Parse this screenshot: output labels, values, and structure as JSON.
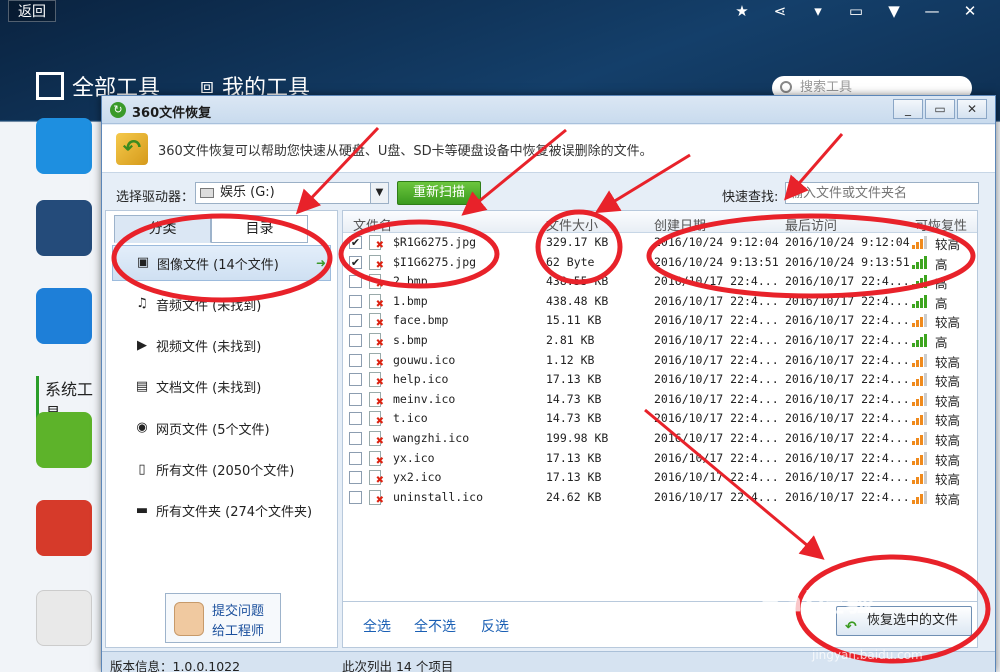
{
  "background": {
    "back_label": "返回",
    "tabs": [
      "全部工具",
      "我的工具"
    ],
    "search_placeholder": "搜索工具",
    "section_label": "系统工具"
  },
  "window": {
    "title": "360文件恢复",
    "controls": [
      "minimize-icon",
      "maximize-icon",
      "close-icon"
    ],
    "description": "360文件恢复可以帮助您快速从硬盘、U盘、SD卡等硬盘设备中恢复被误删除的文件。",
    "drive_label": "选择驱动器：",
    "drive_value": "娱乐 (G:)",
    "rescan_label": "重新扫描",
    "quicksearch_label": "快速查找:",
    "quicksearch_placeholder": "输入文件或文件夹名"
  },
  "left_panel": {
    "tabs": [
      "分类",
      "目录"
    ],
    "categories": [
      {
        "label": "图像文件 (14个文件)",
        "icon": "image-icon",
        "active": true
      },
      {
        "label": "音频文件 (未找到)",
        "icon": "music-icon"
      },
      {
        "label": "视频文件 (未找到)",
        "icon": "video-icon"
      },
      {
        "label": "文档文件 (未找到)",
        "icon": "document-icon"
      },
      {
        "label": "网页文件 (5个文件)",
        "icon": "webpage-icon"
      },
      {
        "label": "所有文件 (2050个文件)",
        "icon": "file-icon"
      },
      {
        "label": "所有文件夹 (274个文件夹)",
        "icon": "folder-icon"
      }
    ],
    "feedback_line1": "提交问题",
    "feedback_line2": "给工程师"
  },
  "file_table": {
    "columns": [
      "文件名",
      "文件大小",
      "创建日期",
      "最后访问",
      "可恢复性"
    ],
    "rows": [
      {
        "checked": true,
        "name": "$R1G6275.jpg",
        "size": "329.17 KB",
        "created": "2016/10/24 9:12:04",
        "accessed": "2016/10/24 9:12:04",
        "recover": "较高",
        "bars": 3
      },
      {
        "checked": true,
        "name": "$I1G6275.jpg",
        "size": "62 Byte",
        "created": "2016/10/24 9:13:51",
        "accessed": "2016/10/24 9:13:51",
        "recover": "高",
        "bars": 4
      },
      {
        "checked": false,
        "name": "2.bmp",
        "size": "438.55 KB",
        "created": "2016/10/17 22:4...",
        "accessed": "2016/10/17 22:4...",
        "recover": "高",
        "bars": 4
      },
      {
        "checked": false,
        "name": "1.bmp",
        "size": "438.48 KB",
        "created": "2016/10/17 22:4...",
        "accessed": "2016/10/17 22:4...",
        "recover": "高",
        "bars": 4
      },
      {
        "checked": false,
        "name": "face.bmp",
        "size": "15.11 KB",
        "created": "2016/10/17 22:4...",
        "accessed": "2016/10/17 22:4...",
        "recover": "较高",
        "bars": 3
      },
      {
        "checked": false,
        "name": "s.bmp",
        "size": "2.81 KB",
        "created": "2016/10/17 22:4...",
        "accessed": "2016/10/17 22:4...",
        "recover": "高",
        "bars": 4
      },
      {
        "checked": false,
        "name": "gouwu.ico",
        "size": "1.12 KB",
        "created": "2016/10/17 22:4...",
        "accessed": "2016/10/17 22:4...",
        "recover": "较高",
        "bars": 3
      },
      {
        "checked": false,
        "name": "help.ico",
        "size": "17.13 KB",
        "created": "2016/10/17 22:4...",
        "accessed": "2016/10/17 22:4...",
        "recover": "较高",
        "bars": 3
      },
      {
        "checked": false,
        "name": "meinv.ico",
        "size": "14.73 KB",
        "created": "2016/10/17 22:4...",
        "accessed": "2016/10/17 22:4...",
        "recover": "较高",
        "bars": 3
      },
      {
        "checked": false,
        "name": "t.ico",
        "size": "14.73 KB",
        "created": "2016/10/17 22:4...",
        "accessed": "2016/10/17 22:4...",
        "recover": "较高",
        "bars": 3
      },
      {
        "checked": false,
        "name": "wangzhi.ico",
        "size": "199.98 KB",
        "created": "2016/10/17 22:4...",
        "accessed": "2016/10/17 22:4...",
        "recover": "较高",
        "bars": 3
      },
      {
        "checked": false,
        "name": "yx.ico",
        "size": "17.13 KB",
        "created": "2016/10/17 22:4...",
        "accessed": "2016/10/17 22:4...",
        "recover": "较高",
        "bars": 3
      },
      {
        "checked": false,
        "name": "yx2.ico",
        "size": "17.13 KB",
        "created": "2016/10/17 22:4...",
        "accessed": "2016/10/17 22:4...",
        "recover": "较高",
        "bars": 3
      },
      {
        "checked": false,
        "name": "uninstall.ico",
        "size": "24.62 KB",
        "created": "2016/10/17 22:4...",
        "accessed": "2016/10/17 22:4...",
        "recover": "较高",
        "bars": 3
      }
    ]
  },
  "actions": {
    "select_all": "全选",
    "select_none": "全不选",
    "invert": "反选",
    "restore": "恢复选中的文件"
  },
  "status": {
    "version": "版本信息：1.0.0.1022",
    "summary": "此次列出 14 个项目"
  },
  "colors": {
    "annotation_red": "#e8222a",
    "accent_green": "#3a9a1f",
    "link_blue": "#1a5fb4"
  },
  "watermark": {
    "text": "Bai经验",
    "url": "jingyan.baidu.com"
  }
}
